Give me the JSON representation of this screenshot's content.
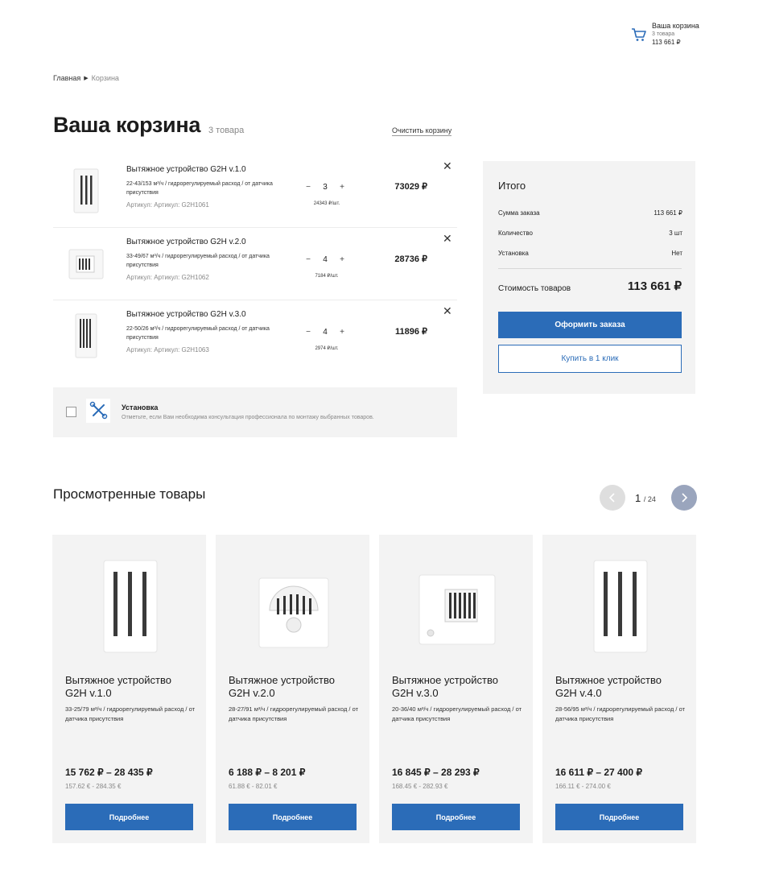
{
  "header": {
    "cart_title": "Ваша корзина",
    "cart_count": "3 товара",
    "cart_total": "113 661 ₽"
  },
  "breadcrumb": [
    "Главная",
    "Корзина"
  ],
  "page": {
    "title": "Ваша корзина",
    "item_count": "3 товара",
    "clear_label": "Очистить корзину"
  },
  "cart_items": [
    {
      "name": "Вытяжное устройство G2H v.1.0",
      "desc": "22-43/153 м³/ч / гидрорегулируемый расход / от датчика присутствия",
      "sku": "Артикул: Артикул: G2H1061",
      "qty": "3",
      "unit_price": "24343 ₽/шт.",
      "sum": "73029 ₽"
    },
    {
      "name": "Вытяжное устройство G2H v.2.0",
      "desc": "33-49/67 м³/ч / гидрорегулируемый расход / от датчика присутствия",
      "sku": "Артикул: Артикул: G2H1062",
      "qty": "4",
      "unit_price": "7184 ₽/шт.",
      "sum": "28736 ₽"
    },
    {
      "name": "Вытяжное устройство G2H v.3.0",
      "desc": "22-50/26 м³/ч / гидрорегулируемый расход / от датчика присутствия",
      "sku": "Артикул: Артикул: G2H1063",
      "qty": "4",
      "unit_price": "2974 ₽/шт.",
      "sum": "11896 ₽"
    }
  ],
  "install": {
    "label": "Установка",
    "hint": "Отметьте, если Вам необходима консультация профессионала по монтажу выбранных товаров."
  },
  "summary": {
    "title": "Итого",
    "rows": [
      {
        "label": "Сумма заказа",
        "value": "113 661 ₽"
      },
      {
        "label": "Количество",
        "value": "3 шт"
      },
      {
        "label": "Установка",
        "value": "Нет"
      }
    ],
    "total_label": "Стоимость товаров",
    "total_value": "113 661 ₽",
    "checkout_label": "Оформить заказа",
    "oneclick_label": "Купить в 1 клик"
  },
  "viewed": {
    "title": "Просмотренные товары",
    "page_current": "1",
    "page_total": "/ 24",
    "products": [
      {
        "name": "Вытяжное устройство G2H v.1.0",
        "desc": "33-25/79 м³/ч / гидрорегулируемый расход / от датчика присутствия",
        "price": "15 762 ₽ – 28 435 ₽",
        "price_eur": "157.62 € - 284.35 €",
        "button": "Подробнее"
      },
      {
        "name": "Вытяжное устройство G2H v.2.0",
        "desc": "28-27/91 м³/ч / гидрорегулируемый расход / от датчика присутствия",
        "price": "6 188 ₽ – 8 201 ₽",
        "price_eur": "61.88 € - 82.01 €",
        "button": "Подробнее"
      },
      {
        "name": "Вытяжное устройство G2H v.3.0",
        "desc": "20-36/40 м³/ч / гидрорегулируемый расход / от датчика присутствия",
        "price": "16 845 ₽ – 28 293 ₽",
        "price_eur": "168.45 € - 282.93 €",
        "button": "Подробнее"
      },
      {
        "name": "Вытяжное устройство G2H v.4.0",
        "desc": "28-56/95 м³/ч / гидрорегулируемый расход / от датчика присутствия",
        "price": "16 611 ₽ – 27 400 ₽",
        "price_eur": "166.11 € - 274.00 €",
        "button": "Подробнее"
      }
    ]
  },
  "colors": {
    "accent": "#2b6cb8",
    "panel": "#f3f3f3",
    "pager_active": "#9aa5bd"
  }
}
